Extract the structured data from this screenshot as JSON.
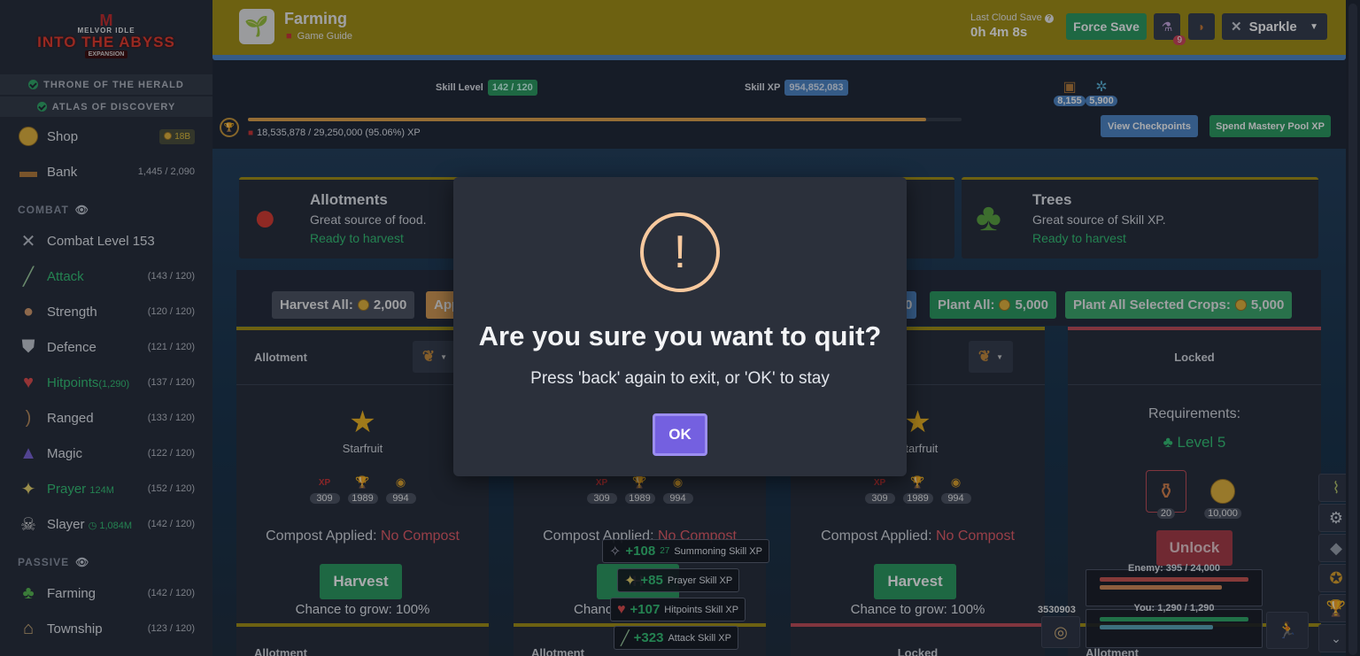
{
  "sidebar": {
    "logo": {
      "line1": "MELVOR IDLE",
      "line2": "INTO THE ABYSS",
      "line3": "EXPANSION"
    },
    "expansions": [
      "THRONE OF THE HERALD",
      "ATLAS OF DISCOVERY"
    ],
    "shop": {
      "label": "Shop",
      "badge": "18B"
    },
    "bank": {
      "label": "Bank",
      "count": "1,445 / 2,090"
    },
    "combat_category": "COMBAT",
    "combat_items": [
      {
        "label": "Combat Level 153",
        "value": ""
      },
      {
        "label": "Attack",
        "value": "(143 / 120)"
      },
      {
        "label": "Strength",
        "value": "(120 / 120)"
      },
      {
        "label": "Defence",
        "value": "(121 / 120)"
      },
      {
        "label": "Hitpoints",
        "extra": "(1,290)",
        "value": "(137 / 120)"
      },
      {
        "label": "Ranged",
        "value": "(133 / 120)"
      },
      {
        "label": "Magic",
        "value": "(122 / 120)"
      },
      {
        "label": "Prayer",
        "extra": "124M",
        "value": "(152 / 120)"
      },
      {
        "label": "Slayer",
        "extra": "1,084M",
        "value": "(142 / 120)"
      }
    ],
    "passive_category": "PASSIVE",
    "passive_items": [
      {
        "label": "Farming",
        "value": "(142 / 120)"
      },
      {
        "label": "Township",
        "value": "(123 / 120)"
      }
    ]
  },
  "header": {
    "title": "Farming",
    "guide": "Game Guide",
    "cloud_save_label": "Last Cloud Save",
    "cloud_save_value": "0h 4m 8s",
    "force_save": "Force Save",
    "potion_badge": "9",
    "character": "Sparkle"
  },
  "skill": {
    "level_label": "Skill Level",
    "level_value": "142 / 120",
    "xp_label": "Skill XP",
    "xp_value": "954,852,083",
    "pool_text": "18,535,878 / 29,250,000 (95.06%) XP",
    "pool_fraction": 0.9506,
    "mastery_tokens": "8,155",
    "mastery_tokens2": "5,900",
    "view_checkpoints": "View Checkpoints",
    "spend_mastery": "Spend Mastery Pool XP"
  },
  "categories": [
    {
      "title": "Allotments",
      "desc": "Great source of food.",
      "state": "Ready to harvest"
    },
    {
      "title": "Trees",
      "desc": "Great source of Skill XP.",
      "state": "Ready to harvest"
    }
  ],
  "actions": {
    "harvest_all": "Harvest All:",
    "harvest_all_cost": "2,000",
    "apply_partial": "App",
    "partial_cost": "0",
    "plant_all": "Plant All:",
    "plant_all_cost": "5,000",
    "plant_selected": "Plant All Selected Crops:",
    "plant_selected_cost": "5,000"
  },
  "plots": [
    {
      "head": "Allotment",
      "crop": "Starfruit",
      "stats": [
        "309",
        "1989",
        "994"
      ],
      "compost_label": "Compost Applied:",
      "compost_value": "No Compost",
      "button": "Harvest",
      "chance": "Chance to grow: 100%"
    },
    {
      "head": "",
      "crop": "",
      "stats": [
        "309",
        "1989",
        "994"
      ],
      "compost_label": "Compost Applied:",
      "compost_value": "No Compost",
      "button": "H",
      "chance": "Chanc"
    },
    {
      "head": "",
      "crop": "Starfruit",
      "stats": [
        "309",
        "1989",
        "994"
      ],
      "compost_label": "Compost Applied:",
      "compost_value": "No Compost",
      "button": "Harvest",
      "chance": "Chance to grow: 100%"
    }
  ],
  "locked_plot": {
    "head": "Locked",
    "req_title": "Requirements:",
    "req_level": "Level 5",
    "item1_qty": "20",
    "item2_qty": "10,000",
    "button": "Unlock"
  },
  "row2": [
    "Allotment",
    "Allotment",
    "Locked",
    "Allotment"
  ],
  "xp_popups": [
    {
      "amount": "+108",
      "sup": "27",
      "label": "Summoning Skill XP"
    },
    {
      "amount": "+85",
      "label": "Prayer Skill XP"
    },
    {
      "amount": "+107",
      "label": "Hitpoints Skill XP"
    },
    {
      "amount": "+323",
      "label": "Attack Skill XP"
    }
  ],
  "combat_mini": {
    "enemy": "Enemy: 395 / 24,000",
    "you": "You: 1,290 / 1,290",
    "counter": "3530903"
  },
  "modal": {
    "icon": "!",
    "title": "Are you sure you want to quit?",
    "text": "Press 'back' again to exit, or 'OK' to stay",
    "ok": "OK"
  },
  "colors": {
    "header": "#a48f12",
    "sidebar": "#262c38",
    "accent_green": "#2a9a5e",
    "accent_blue": "#4d86c7",
    "ok_button": "#7460e0"
  }
}
